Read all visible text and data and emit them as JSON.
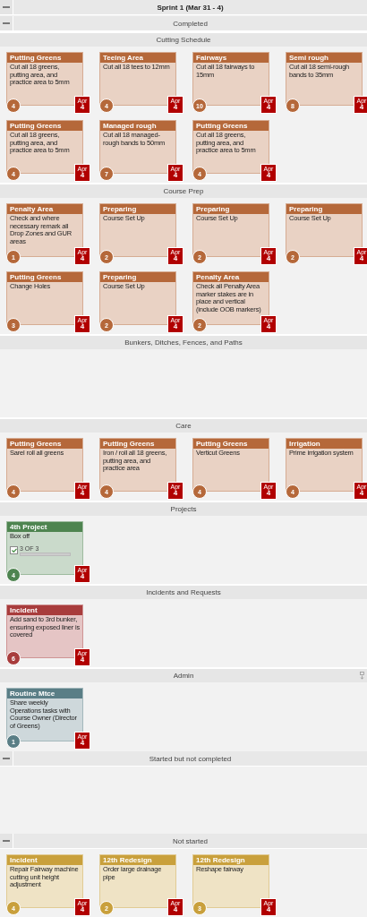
{
  "sprint": {
    "title": "Sprint 1 (Mar 31 - 4)",
    "collapsible": true
  },
  "groups": [
    {
      "title": "Completed",
      "collapsible": true,
      "lanes": [
        {
          "title": "Cutting Schedule",
          "cards": [
            {
              "category": "Putting Greens",
              "text": "Cut all 18 greens, putting area, and practice area to 5mm",
              "points": "4",
              "color": "#b5683a",
              "due": {
                "month": "Apr",
                "day": "4"
              }
            },
            {
              "category": "Teeing Area",
              "text": "Cut all 18 tees to 12mm",
              "points": "4",
              "color": "#b5683a",
              "due": {
                "month": "Apr",
                "day": "4"
              }
            },
            {
              "category": "Fairways",
              "text": "Cut all 18 fairways to 15mm",
              "points": "10",
              "color": "#b5683a",
              "due": {
                "month": "Apr",
                "day": "4"
              }
            },
            {
              "category": "Semi rough",
              "text": "Cut all 18 semi-rough bands to 35mm",
              "points": "8",
              "color": "#b5683a",
              "due": {
                "month": "Apr",
                "day": "4"
              }
            },
            {
              "category": "Putting Greens",
              "text": "Cut all 18 greens, putting area, and practice area to 5mm",
              "points": "4",
              "color": "#b5683a",
              "due": {
                "month": "Apr",
                "day": "4"
              }
            },
            {
              "category": "Managed rough",
              "text": "Cut all 18 managed-rough bands to 50mm",
              "points": "7",
              "color": "#b5683a",
              "due": {
                "month": "Apr",
                "day": "4"
              }
            },
            {
              "category": "Putting Greens",
              "text": "Cut all 18 greens, putting area, and practice area to 5mm",
              "points": "4",
              "color": "#b5683a",
              "due": {
                "month": "Apr",
                "day": "4"
              }
            }
          ]
        },
        {
          "title": "Course Prep",
          "cards": [
            {
              "category": "Penalty Area",
              "text": "Check and where necessary remark all Drop Zones and GUR areas",
              "points": "1",
              "color": "#b5683a",
              "due": {
                "month": "Apr",
                "day": "4"
              }
            },
            {
              "category": "Preparing",
              "text": "Course Set Up",
              "points": "2",
              "color": "#b5683a",
              "due": {
                "month": "Apr",
                "day": "4"
              }
            },
            {
              "category": "Preparing",
              "text": "Course Set Up",
              "points": "2",
              "color": "#b5683a",
              "due": {
                "month": "Apr",
                "day": "4"
              }
            },
            {
              "category": "Preparing",
              "text": "Course Set Up",
              "points": "2",
              "color": "#b5683a",
              "due": {
                "month": "Apr",
                "day": "4"
              }
            },
            {
              "category": "Putting Greens",
              "text": "Change Holes",
              "points": "3",
              "color": "#b5683a",
              "due": {
                "month": "Apr",
                "day": "4"
              }
            },
            {
              "category": "Preparing",
              "text": "Course Set Up",
              "points": "2",
              "color": "#b5683a",
              "due": {
                "month": "Apr",
                "day": "4"
              }
            },
            {
              "category": "Penalty Area",
              "text": "Check all Penalty Area marker stakes are in place and vertical (include OOB markers)",
              "points": "2",
              "color": "#b5683a",
              "due": {
                "month": "Apr",
                "day": "4"
              }
            }
          ]
        },
        {
          "title": "Bunkers, Ditches, Fences, and Paths"
        },
        {
          "title": "Care",
          "cards": [
            {
              "category": "Putting Greens",
              "text": "Sarel roll all greens",
              "points": "4",
              "color": "#b5683a",
              "due": {
                "month": "Apr",
                "day": "4"
              }
            },
            {
              "category": "Putting Greens",
              "text": "Iron / roll all 18 greens, putting area, and practice area",
              "points": "4",
              "color": "#b5683a",
              "due": {
                "month": "Apr",
                "day": "4"
              }
            },
            {
              "category": "Putting Greens",
              "text": "Verticut Greens",
              "points": "4",
              "color": "#b5683a",
              "due": {
                "month": "Apr",
                "day": "4"
              }
            },
            {
              "category": "Irrigation",
              "text": "Prime irrigation system",
              "points": "4",
              "color": "#b5683a",
              "due": {
                "month": "Apr",
                "day": "4"
              }
            }
          ]
        },
        {
          "title": "Projects",
          "cards": [
            {
              "category": "4th Project",
              "text": "Box off",
              "points": "4",
              "color": "#4e8450",
              "due": {
                "month": "Apr",
                "day": "4"
              },
              "checklist": {
                "checked": true,
                "count": "3 OF 3",
                "level": 1
              }
            }
          ]
        },
        {
          "title": "Incidents and Requests",
          "cards": [
            {
              "category": "Incident",
              "text": "Add sand to 3rd bunker, ensuring exposed liner is covered",
              "points": "6",
              "color": "#a83c3c",
              "due": {
                "month": "Apr",
                "day": "4"
              }
            }
          ]
        },
        {
          "title": "Admin",
          "menu": true,
          "cards": [
            {
              "category": "Routine Mtce",
              "text": "Share weekly Operations tasks with Course Owner (Director of Greens)",
              "points": "1",
              "color": "#5a7e86",
              "due": {
                "month": "Apr",
                "day": "4"
              }
            }
          ]
        }
      ]
    },
    {
      "title": "Started but not completed",
      "collapsible": true
    },
    {
      "title": "Not started",
      "collapsible": true,
      "lanes": [
        {
          "cards": [
            {
              "category": "Incident",
              "text": "Repair Fairway machine cutting unit height adjustment",
              "points": "4",
              "color": "#c9a03c",
              "due": {
                "month": "Apr",
                "day": "4"
              }
            },
            {
              "category": "12th Redesign",
              "text": "Order large drainage pipe",
              "points": "2",
              "color": "#c9a03c",
              "due": {
                "month": "Apr",
                "day": "4"
              }
            },
            {
              "category": "12th Redesign",
              "text": "Reshape fairway",
              "points": "3",
              "color": "#c9a03c",
              "due": {
                "month": "Apr",
                "day": "4"
              }
            }
          ]
        }
      ]
    }
  ]
}
